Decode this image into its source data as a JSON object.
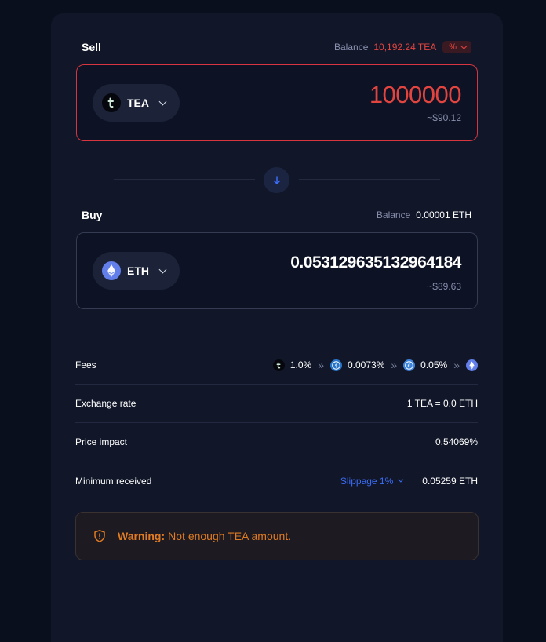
{
  "sell": {
    "title": "Sell",
    "balance_label": "Balance",
    "balance_value": "10,192.24 TEA",
    "percent_label": "%",
    "token": "TEA",
    "token_icon": "tea-icon",
    "amount": "1000000",
    "usd": "~$90.12"
  },
  "buy": {
    "title": "Buy",
    "balance_label": "Balance",
    "balance_value": "0.00001 ETH",
    "token": "ETH",
    "token_icon": "eth-icon",
    "amount": "0.05312963513296 4184",
    "usd": "~$89.63"
  },
  "details": {
    "fees": {
      "label": "Fees",
      "hops": [
        "1.0%",
        "0.0073%",
        "0.05%"
      ],
      "separator": "»"
    },
    "exchange_rate": {
      "label": "Exchange rate",
      "value": "1 TEA = 0.0 ETH"
    },
    "price_impact": {
      "label": "Price impact",
      "value": "0.54069%"
    },
    "minimum_received": {
      "label": "Minimum received",
      "slippage": "Slippage 1%",
      "value": "0.05259 ETH"
    }
  },
  "warning": {
    "label": "Warning:",
    "message": "Not enough TEA amount."
  },
  "colors": {
    "error": "#e2443f",
    "accent": "#3b6cf6",
    "warning": "#e07b22",
    "background": "#0a0f1d",
    "panel": "#111729"
  }
}
